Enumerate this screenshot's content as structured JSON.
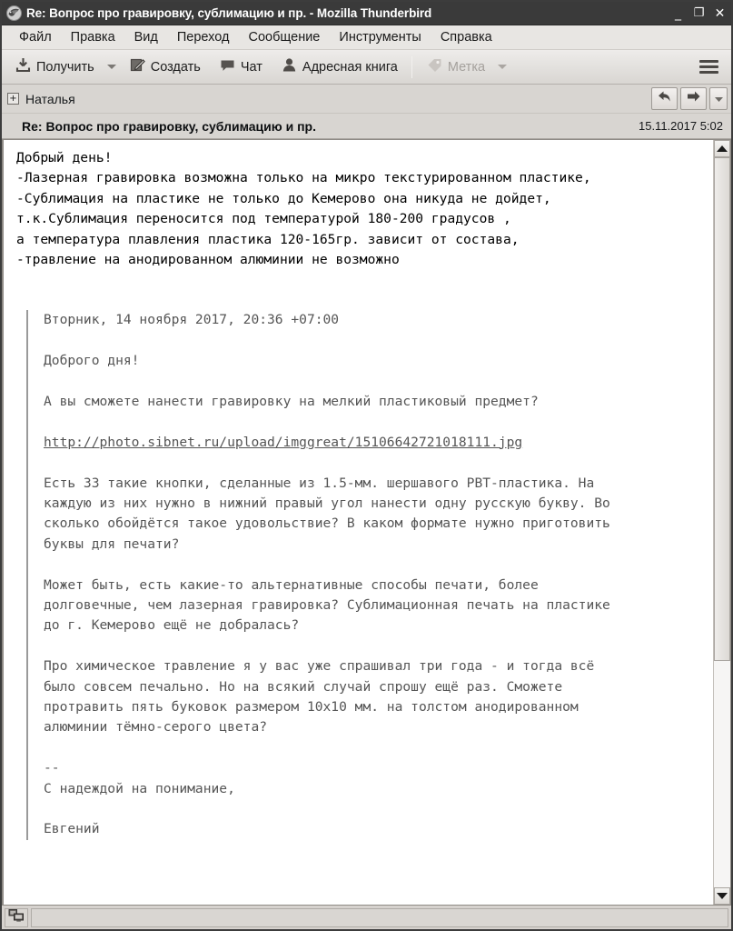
{
  "window": {
    "title": "Re: Вопрос про гравировку, сублимацию и пр. - Mozilla Thunderbird",
    "app_icon": "thunderbird-icon",
    "minimize_label": "_",
    "maximize_label": "❐",
    "close_label": "✕"
  },
  "menubar": {
    "items": [
      {
        "label": "Файл",
        "accel": "Ф"
      },
      {
        "label": "Правка",
        "accel": "П"
      },
      {
        "label": "Вид",
        "accel": "В"
      },
      {
        "label": "Переход",
        "accel": "е"
      },
      {
        "label": "Сообщение",
        "accel": "б"
      },
      {
        "label": "Инструменты",
        "accel": "И"
      },
      {
        "label": "Справка",
        "accel": "С"
      }
    ]
  },
  "toolbar": {
    "get_label": "Получить",
    "get_icon": "download-inbox-icon",
    "write_label": "Создать",
    "write_icon": "compose-pencil-icon",
    "chat_label": "Чат",
    "chat_icon": "chat-bubble-icon",
    "addressbook_label": "Адресная книга",
    "addressbook_icon": "person-icon",
    "tag_label": "Метка",
    "tag_icon": "tag-icon",
    "tag_disabled": true,
    "menu_icon": "hamburger-menu-icon"
  },
  "message_header": {
    "expander_label": "+",
    "sender": "Наталья",
    "subject": "Re: Вопрос про гравировку, сублимацию и пр.",
    "date": "15.11.2017 5:02",
    "reply_icon": "reply-arrow-icon",
    "forward_icon": "forward-arrow-icon",
    "more_icon": "chevron-down-icon"
  },
  "message_body": {
    "reply_text": "Добрый день!\n-Лазерная гравировка возможна только на микро текстурированном пластике,\n-Сублимация на пластике не только до Кемерово она никуда не дойдет,\nт.к.Сублимация переносится под температурой 180-200 градусов ,\nа температура плавления пластика 120-165гр. зависит от состава,\n-травление на анодированном алюминии не возможно",
    "quote": {
      "date_line": "Вторник, 14 ноября 2017, 20:36 +07:00",
      "greeting": "Доброго дня!",
      "paragraph_1": "А вы сможете нанести гравировку на мелкий пластиковый предмет?",
      "link": "http://photo.sibnet.ru/upload/imggreat/15106642721018111.jpg",
      "paragraph_2": "Есть 33 такие кнопки, сделанные из 1.5-мм. шершавого PBT-пластика. На\nкаждую из них нужно в нижний правый угол нанести одну русскую букву. Во\nсколько обойдётся такое удовольствие? В каком формате нужно приготовить\nбуквы для печати?",
      "paragraph_3": "Может быть, есть какие-то альтернативные способы печати, более\nдолговечные, чем лазерная гравировка? Сублимационная печать на пластике\nдо г. Кемерово ещё не добралась?",
      "paragraph_4": "Про химическое травление я у вас уже спрашивал три года - и тогда всё\nбыло совсем печально. Но на всякий случай спрошу ещё раз. Сможете\nпротравить пять буковок размером 10x10 мм. на толстом анодированном\nалюминии тёмно-серого цвета?",
      "signature_separator": "--",
      "signature_line": "С надеждой на понимание,",
      "signature_name": "Евгений"
    }
  },
  "scrollbar": {
    "up_icon": "scroll-up-arrow-icon",
    "down_icon": "scroll-down-arrow-icon",
    "thumb_position_percent": 0
  },
  "statusbar": {
    "connection_icon": "network-computers-icon",
    "status_text": ""
  },
  "colors": {
    "titlebar_bg": "#3a3a3a",
    "chrome_bg": "#d6d2ce",
    "toolbar_bg": "#e4e2df",
    "body_bg": "#ffffff",
    "quote_text": "#555555",
    "body_text": "#000000"
  }
}
